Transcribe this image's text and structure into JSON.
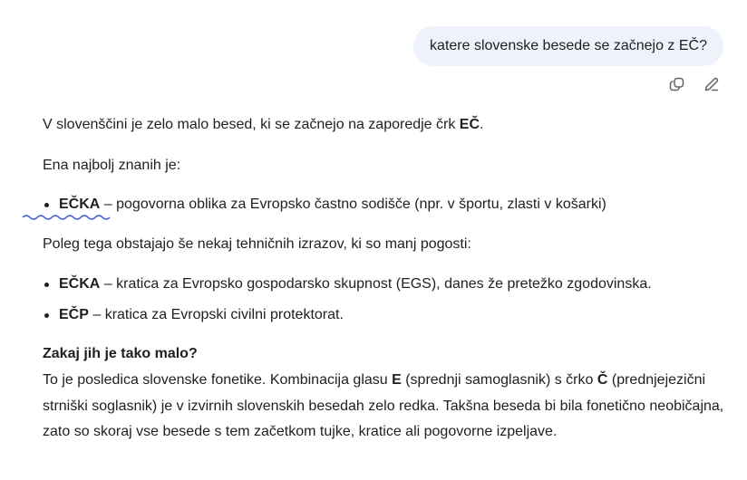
{
  "user_message": {
    "text": "katere slovenske besede se začnejo z EČ?"
  },
  "message_actions": {
    "copy_icon": "copy-icon",
    "edit_icon": "edit-pencil-icon"
  },
  "answer": {
    "intro_prefix": "V slovenščini je zelo malo besed, ki se začnejo na zaporedje črk ",
    "intro_bold": "EČ",
    "intro_suffix": ".",
    "known_heading": "Ena najbolj znanih je:",
    "known_items": [
      {
        "term": "EČKA",
        "description": " – pogovorna oblika za Evropsko častno sodišče (npr. v športu, zlasti v košarki)"
      }
    ],
    "also_text": "Poleg tega obstajajo še nekaj tehničnih izrazov, ki so manj pogosti:",
    "technical_items": [
      {
        "term": "EČKA",
        "description": " – kratica za Evropsko gospodarsko skupnost (EGS), danes že pretežko zgodovinska."
      },
      {
        "term": "EČP",
        "description": " – kratica za Evropski civilni protektorat."
      }
    ],
    "why_heading": "Zakaj jih je tako malo?",
    "why_parts": {
      "p1": "To je posledica slovenske fonetike. Kombinacija glasu ",
      "b1": "E",
      "p2": " (sprednji samoglasnik) s črko ",
      "b2": "Č",
      "p3": " (prednjejezični strniški soglasnik) je v izvirnih slovenskih besedah zelo redka. Takšna beseda bi bila fonetično neobičajna, zato so skoraj vse besede s tem začetkom tujke, kratice ali pogovorne izpeljave."
    }
  },
  "colors": {
    "bubble_bg": "#eef2fb",
    "text": "#1f1f1f",
    "icon": "#5f6368",
    "squiggle": "#3b5bdb"
  }
}
